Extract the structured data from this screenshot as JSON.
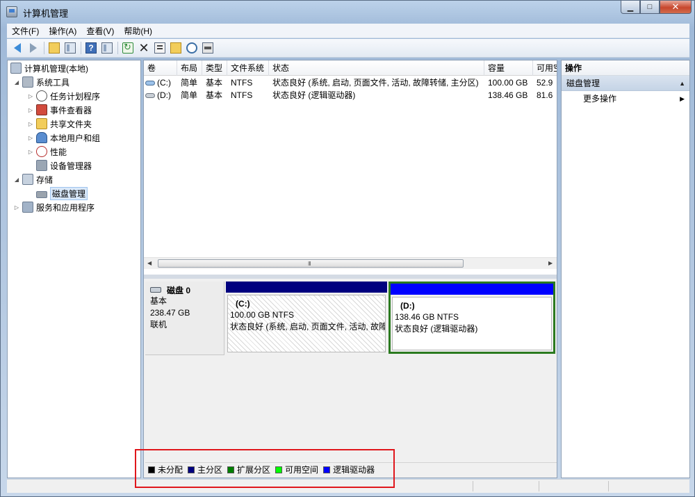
{
  "window": {
    "title": "计算机管理",
    "minimize": "▁",
    "maximize": "□",
    "close": "✕"
  },
  "menu": [
    "文件(F)",
    "操作(A)",
    "查看(V)",
    "帮助(H)"
  ],
  "toolbar": {
    "help_glyph": "?",
    "delete_glyph": "✕"
  },
  "tree": {
    "root": "计算机管理(本地)",
    "system_tools": "系统工具",
    "task_scheduler": "任务计划程序",
    "event_viewer": "事件查看器",
    "shared_folders": "共享文件夹",
    "local_users": "本地用户和组",
    "performance": "性能",
    "device_manager": "设备管理器",
    "storage": "存储",
    "disk_management": "磁盘管理",
    "services_apps": "服务和应用程序"
  },
  "volume_list": {
    "columns": [
      "卷",
      "布局",
      "类型",
      "文件系统",
      "状态",
      "容量",
      "可用空"
    ],
    "rows": [
      [
        "(C:)",
        "简单",
        "基本",
        "NTFS",
        "状态良好 (系统, 启动, 页面文件, 活动, 故障转储, 主分区)",
        "100.00 GB",
        "52.9"
      ],
      [
        "(D:)",
        "简单",
        "基本",
        "NTFS",
        "状态良好 (逻辑驱动器)",
        "138.46 GB",
        "81.6"
      ]
    ],
    "scroll_grip": "III"
  },
  "disk": {
    "name": "磁盘 0",
    "type": "基本",
    "size": "238.47 GB",
    "status": "联机",
    "partitions": [
      {
        "name": "(C:)",
        "size": "100.00 GB NTFS",
        "status": "状态良好 (系统, 启动, 页面文件, 活动, 故障",
        "bar_color": "#00007f"
      },
      {
        "name": "(D:)",
        "size": "138.46 GB NTFS",
        "status": "状态良好 (逻辑驱动器)",
        "bar_color": "#0000ff"
      }
    ]
  },
  "legend": [
    {
      "label": "未分配",
      "color": "#000000"
    },
    {
      "label": "主分区",
      "color": "#00007f"
    },
    {
      "label": "扩展分区",
      "color": "#007f00"
    },
    {
      "label": "可用空间",
      "color": "#00ff00"
    },
    {
      "label": "逻辑驱动器",
      "color": "#0000ff"
    }
  ],
  "actions": {
    "header": "操作",
    "section": "磁盘管理",
    "more": "更多操作"
  }
}
